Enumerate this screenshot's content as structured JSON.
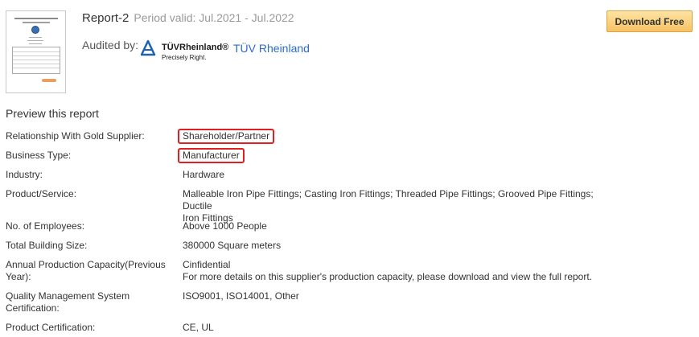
{
  "report": {
    "title": "Report-2",
    "period": "Period valid: Jul.2021 - Jul.2022",
    "audited_label": "Audited by:",
    "auditor_name": "TÜV Rheinland",
    "logo_text": "TÜVRheinland®",
    "logo_tagline": "Precisely Right."
  },
  "download_label": "Download Free",
  "preview_heading": "Preview this report",
  "rows": [
    {
      "label": "Relationship With Gold Supplier:",
      "value": "Shareholder/Partner"
    },
    {
      "label": "Business Type:",
      "value": "Manufacturer"
    },
    {
      "label": "Industry:",
      "value": "Hardware"
    },
    {
      "label": "Product/Service:",
      "value": "Malleable Iron Pipe Fittings; Casting Iron Fittings; Threaded Pipe Fittings; Grooved Pipe Fittings; Ductile",
      "value2": "Iron Fittings"
    },
    {
      "label": "No. of Employees:",
      "value": "Above 1000 People"
    },
    {
      "label": "Total Building Size:",
      "value": "380000 Square meters"
    },
    {
      "label": "Annual Production Capacity(Previous",
      "label2": "Year):",
      "value": "Cinfidential",
      "value2": "For more details on this supplier's production capacity, please download and view the full report."
    },
    {
      "label": "Quality Management System",
      "label2": "Certification:",
      "value": "ISO9001, ISO14001, Other"
    },
    {
      "label": "Product Certification:",
      "value": "CE, UL"
    }
  ],
  "colors": {
    "link": "#2a6ad2",
    "highlight_border": "#e02020",
    "button": "#f7c264"
  },
  "icons": [
    "report-thumbnail",
    "tuv-logo-icon"
  ]
}
